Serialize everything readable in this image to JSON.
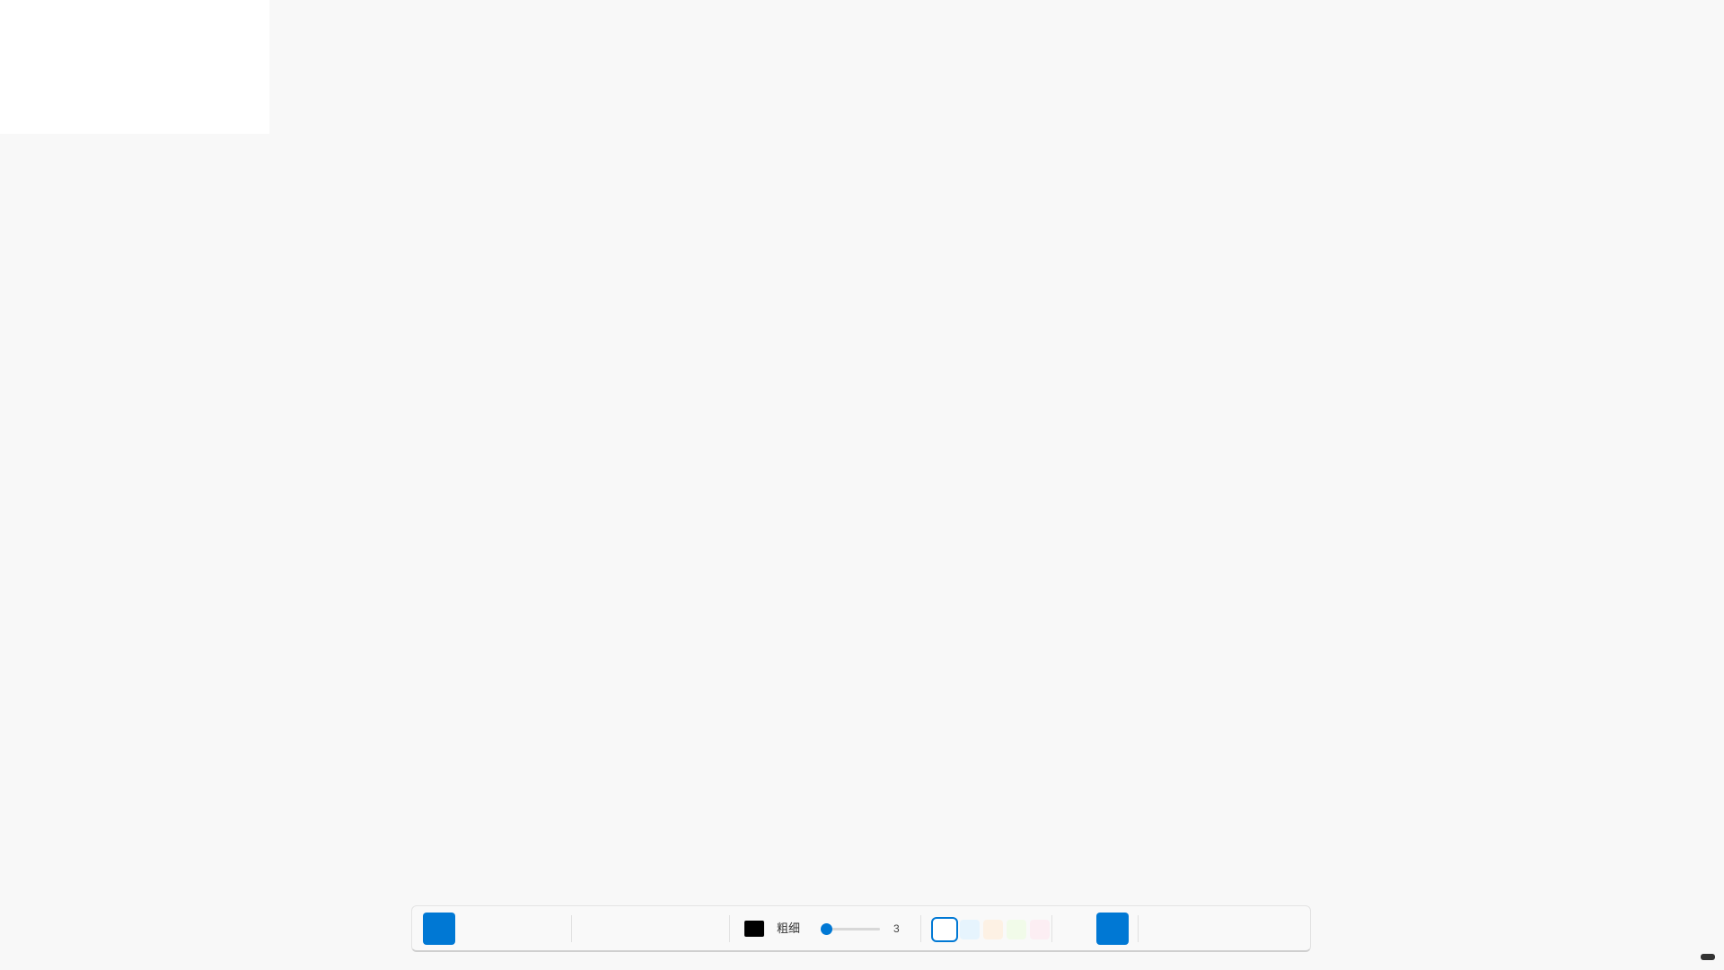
{
  "toolbar": {
    "pen_color": "#000000",
    "width_label": "粗细",
    "width_value": "3",
    "width_slider_fraction": 0.03,
    "background_swatches": [
      {
        "name": "white",
        "color": "#ffffff",
        "selected": true
      },
      {
        "name": "light-blue",
        "color": "#e6f4fd",
        "selected": false
      },
      {
        "name": "light-peach",
        "color": "#fdf1e4",
        "selected": false
      },
      {
        "name": "light-green",
        "color": "#f1fbe9",
        "selected": false
      },
      {
        "name": "light-pink",
        "color": "#fceef3",
        "selected": false
      }
    ],
    "accent_color": "#0078d4"
  }
}
